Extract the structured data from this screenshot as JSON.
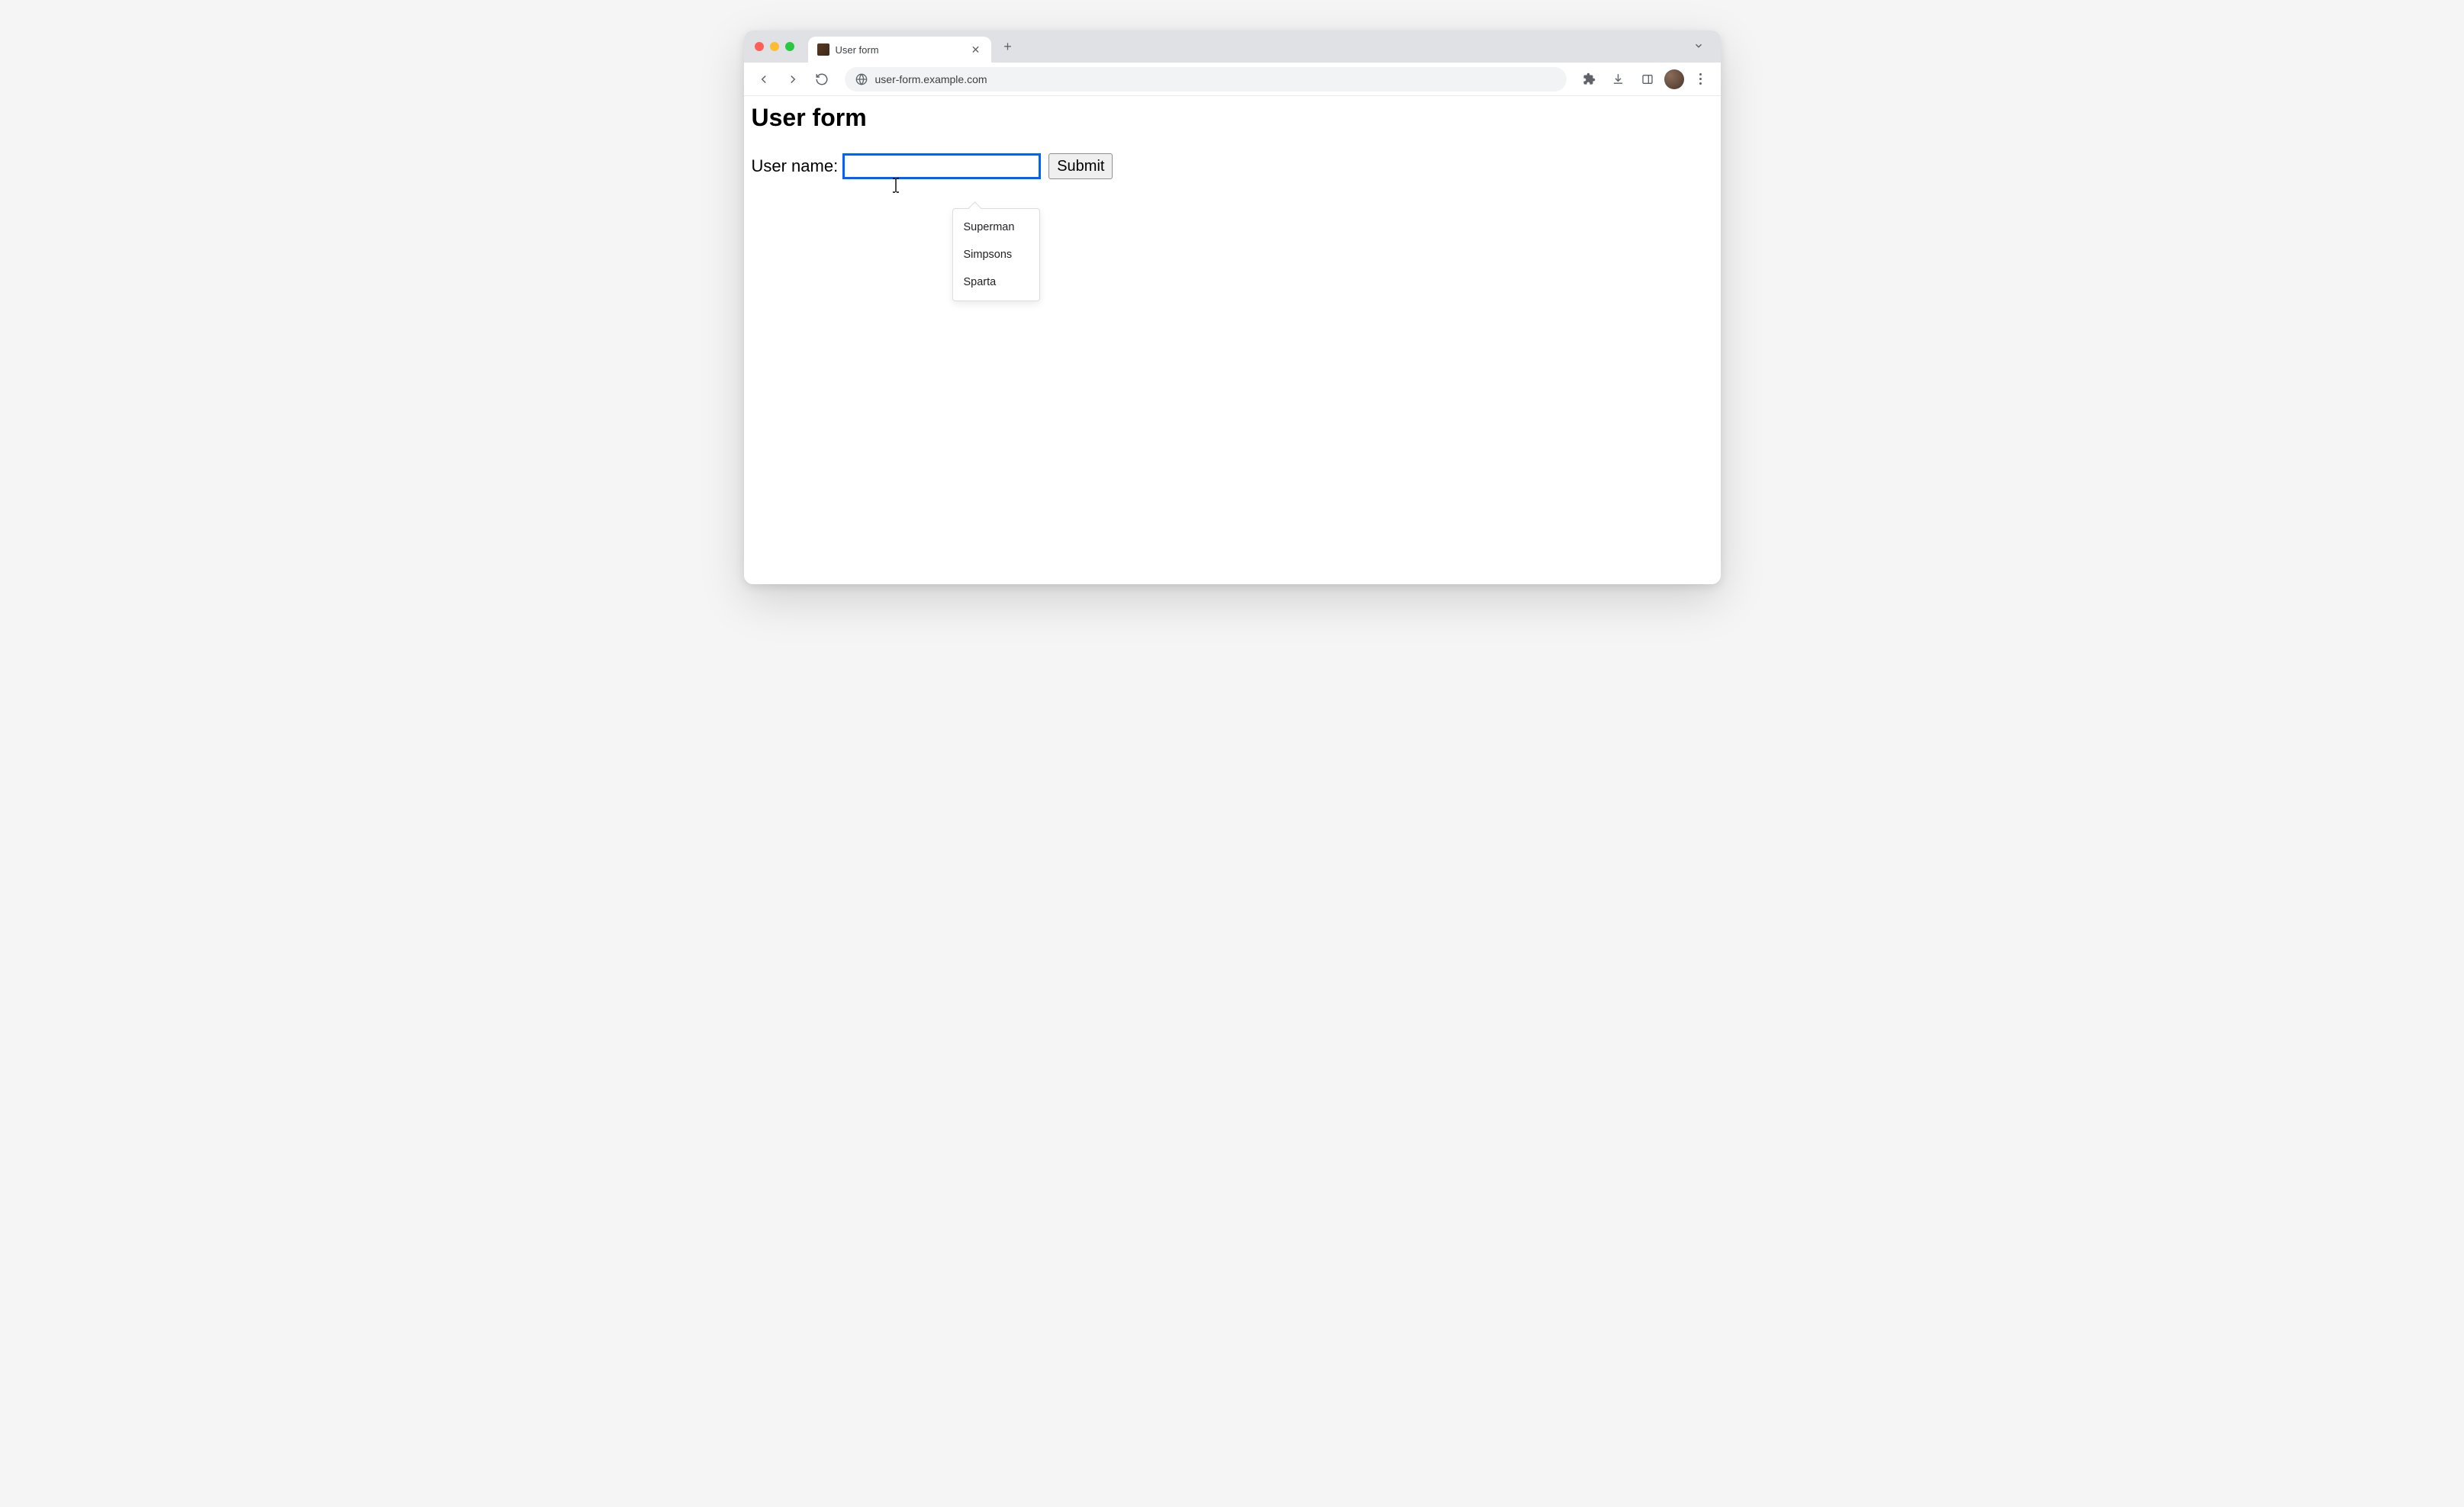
{
  "browser": {
    "tab": {
      "title": "User form"
    },
    "url": "user-form.example.com"
  },
  "page": {
    "heading": "User form",
    "form": {
      "label": "User name:",
      "input_value": "",
      "submit_label": "Submit"
    },
    "autocomplete": {
      "items": [
        "Superman",
        "Simpsons",
        "Sparta"
      ]
    }
  }
}
